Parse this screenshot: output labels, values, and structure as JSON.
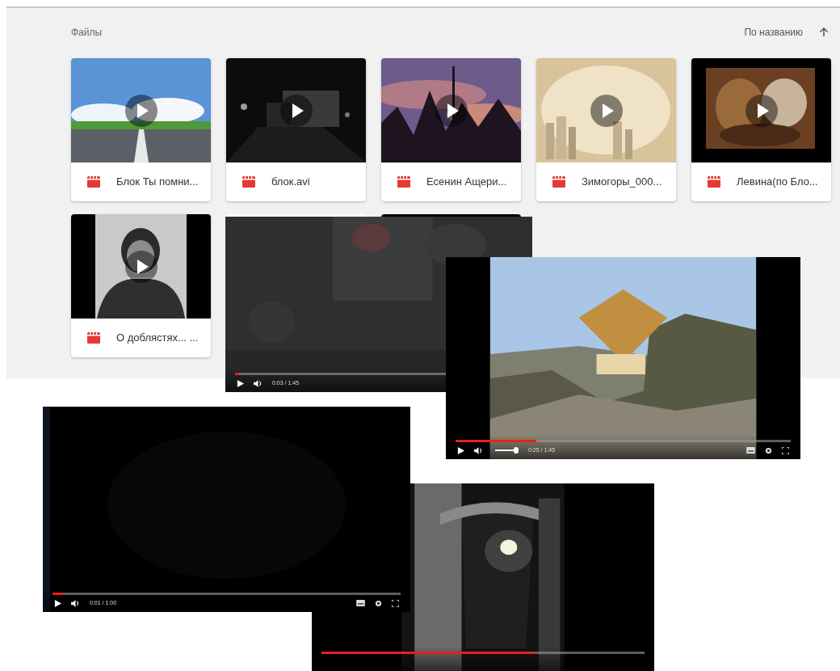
{
  "section": {
    "title": "Файлы",
    "sort": {
      "label": "По названию"
    }
  },
  "files": [
    {
      "name": "Блок Ты помни..."
    },
    {
      "name": "блок.avi"
    },
    {
      "name": "Есенин Ащери..."
    },
    {
      "name": "Зимогоры_000..."
    },
    {
      "name": "Левина(по Бло..."
    },
    {
      "name": "О доблястях... ..."
    }
  ],
  "videos": [
    {
      "progress": {
        "level": 0.02
      },
      "time": "0:03 / 1:45"
    },
    {
      "progress": {
        "level": 0.24
      },
      "volume": {
        "level": 1
      },
      "time": "0:25 / 1:45",
      "toolbar_icons": true
    },
    {
      "progress": {
        "level": 0.66
      }
    },
    {
      "progress": {
        "level": 0.03
      },
      "time": "0:01 / 1:00",
      "toolbar_icons": true
    }
  ]
}
